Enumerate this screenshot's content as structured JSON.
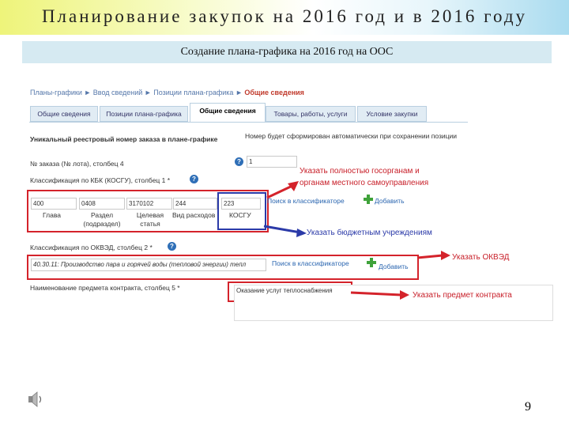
{
  "slide": {
    "title": "Планирование закупок на 2016 год и в 2016 году",
    "subtitle": "Создание плана-графика на 2016 год на ООС",
    "page_number": "9"
  },
  "breadcrumb": {
    "items": [
      "Планы-графики",
      "Ввод сведений",
      "Позиции плана-графика"
    ],
    "current": "Общие сведения"
  },
  "tabs": [
    {
      "label": "Общие сведения"
    },
    {
      "label": "Позиции плана-графика"
    },
    {
      "label": "Общие сведения"
    },
    {
      "label": "Товары, работы, услуги"
    },
    {
      "label": "Условие закупки"
    }
  ],
  "form": {
    "registry_label": "Уникальный реестровый номер заказа в плане-графике",
    "registry_note": "Номер будет сформирован автоматически при сохранении позиции",
    "lot_label": "№ заказа (№ лота), столбец 4",
    "lot_value": "1",
    "kbk_label": "Классификация по КБК (КОСГУ), столбец 1 *",
    "kbk_values": [
      "400",
      "0408",
      "3170102",
      "244",
      "223"
    ],
    "kbk_captions": [
      "Глава",
      "Раздел (подраздел)",
      "Целевая статья",
      "Вид расходов",
      "КОСГУ"
    ],
    "search_link": "Поиск в классификаторе",
    "add_label": "Добавить",
    "okved_label": "Классификация по ОКВЭД, столбец 2 *",
    "okved_value": "40.30.11: Производство пара и горячей воды (тепловой энергии) тепл",
    "subject_label": "Наименование предмета контракта, столбец 5 *",
    "subject_value": "Оказание услуг теплоснабжения"
  },
  "annotations": {
    "kbk_note_line1": "Указать полностью госорганам и",
    "kbk_note_line2": "органам местного самоуправления",
    "kosgu_note": "Указать бюджетным учреждениям",
    "okved_note": "Указать ОКВЭД",
    "subject_note": "Указать предмет контракта"
  },
  "colors": {
    "highlight_red": "#d4232b",
    "highlight_blue": "#2b3aa8",
    "subtitle_bg": "#d6eaf2"
  }
}
